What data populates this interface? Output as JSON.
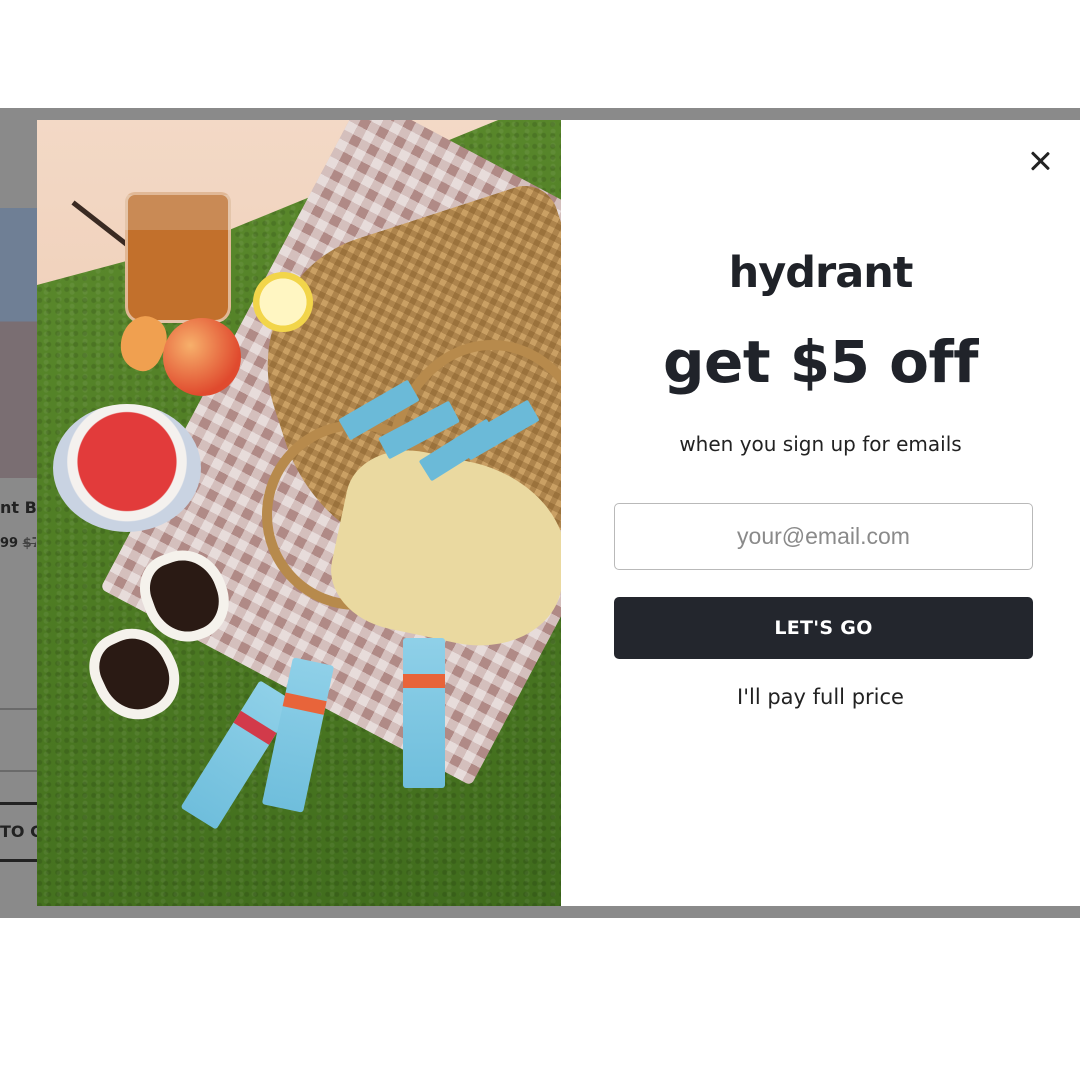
{
  "background_page": {
    "card_title_fragment": "nt Bu",
    "card_price_fragment": "99",
    "card_old_price_fragment": "$7",
    "button_fragment": "TO C"
  },
  "modal": {
    "brand": "hydrant",
    "headline": "get $5 off",
    "subhead": "when you sign up for emails",
    "email_input": {
      "placeholder": "your@email.com",
      "value": ""
    },
    "cta_label": "LET'S GO",
    "decline_label": "I'll pay full price",
    "close_icon": "close-icon"
  },
  "colors": {
    "cta_background": "#23262d",
    "text": "#20232a",
    "backdrop": "#8a8a8a"
  }
}
